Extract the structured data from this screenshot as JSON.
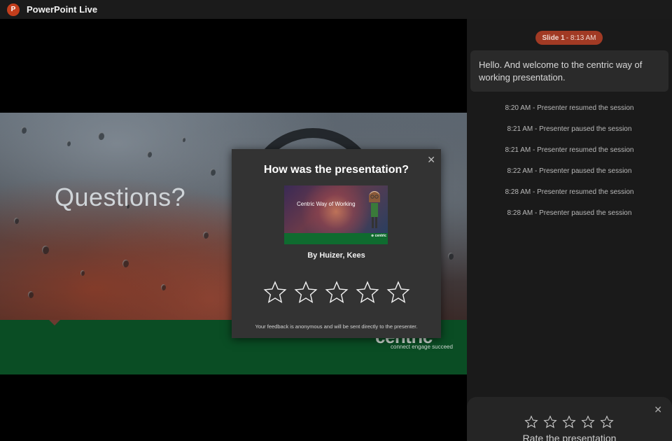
{
  "app": {
    "title": "PowerPoint Live",
    "logo_letter": "P"
  },
  "slide": {
    "title": "Questions?",
    "brand": "centric",
    "brand_tagline": "connect engage succeed"
  },
  "panel": {
    "slide_pill": {
      "slide": "Slide 1",
      "time": " - 8:13 AM"
    },
    "message": "Hello. And welcome to the centric way of working presentation.",
    "events": [
      "8:20 AM - Presenter resumed the session",
      "8:21 AM - Presenter paused the session",
      "8:21 AM - Presenter resumed the session",
      "8:22 AM - Presenter paused the session",
      "8:28 AM - Presenter resumed the session",
      "8:28 AM - Presenter paused the session"
    ],
    "rate_card": {
      "label": "Rate the presentation",
      "close": "✕"
    }
  },
  "modal": {
    "title": "How was the presentation?",
    "close": "✕",
    "thumbnail": {
      "title": "Centric Way of Working",
      "brand": "⊕ centric"
    },
    "byline": "By Huizer, Kees",
    "footnote": "Your feedback is anonymous and will be sent directly to the presenter."
  },
  "colors": {
    "accent": "#c43e1c",
    "pill": "#a13a24",
    "brand_green": "#0a4d24"
  }
}
